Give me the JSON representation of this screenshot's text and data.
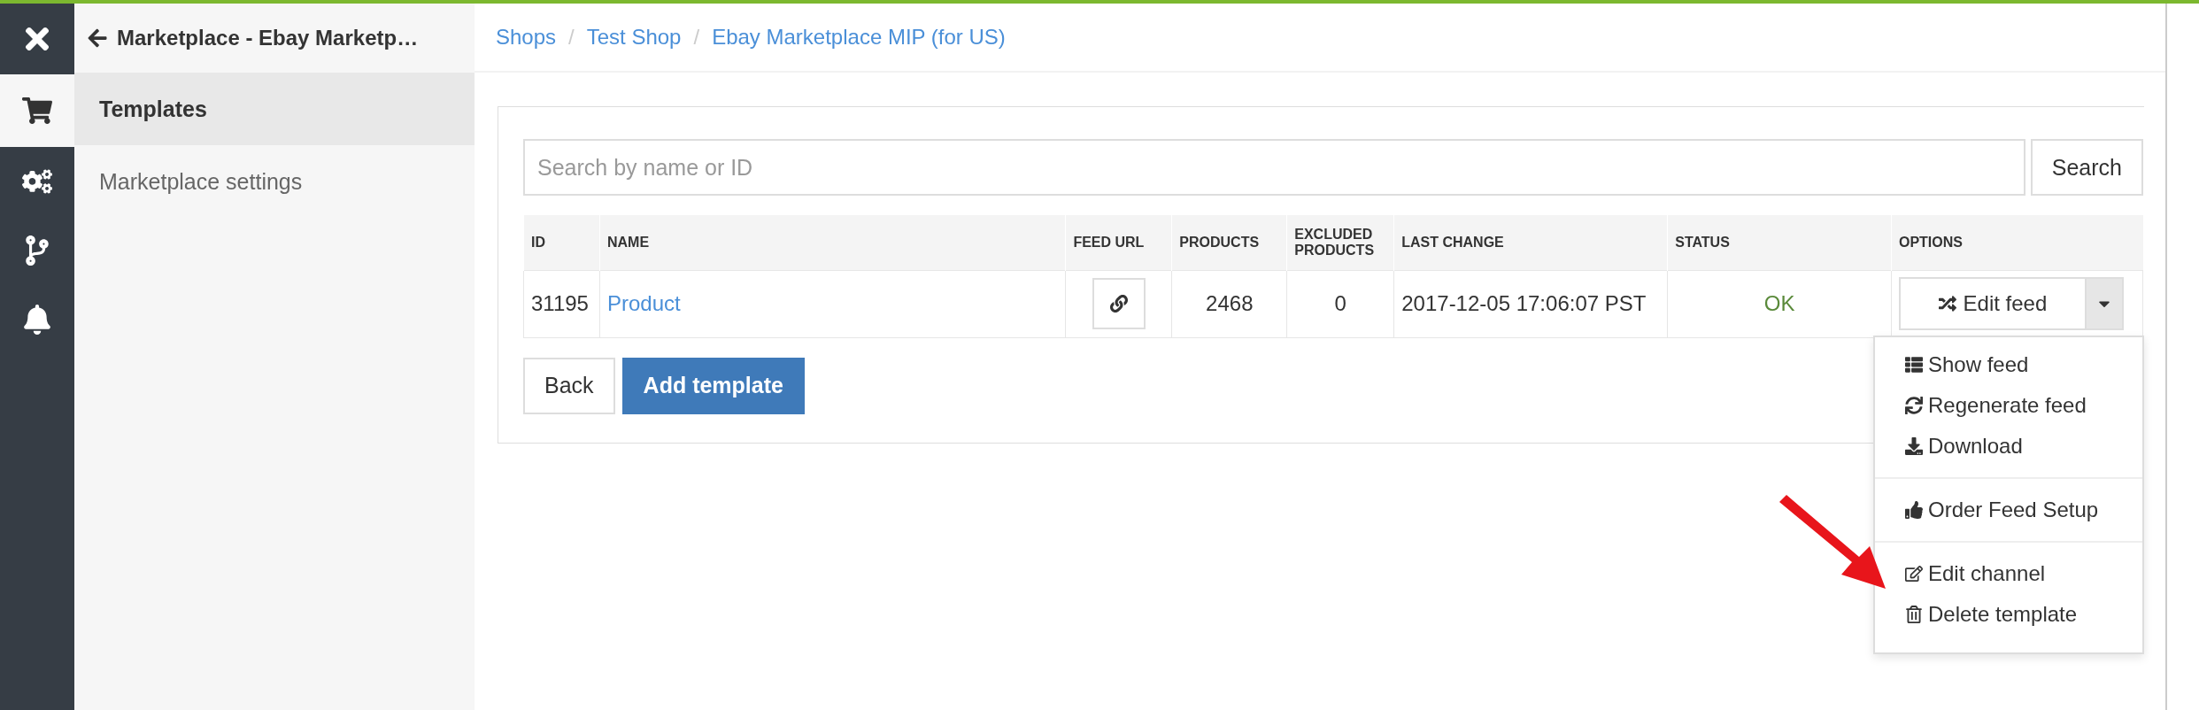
{
  "rail": {
    "items": [
      {
        "kind": "cart",
        "selected": true
      },
      {
        "kind": "settings",
        "selected": false
      },
      {
        "kind": "branch",
        "selected": false
      },
      {
        "kind": "bell",
        "selected": false
      }
    ]
  },
  "sidebar": {
    "title": "Marketplace - Ebay Marketp…",
    "items": [
      {
        "label": "Templates",
        "selected": true
      },
      {
        "label": "Marketplace settings",
        "selected": false
      }
    ]
  },
  "breadcrumb": {
    "separator": "/",
    "items": [
      "Shops",
      "Test Shop",
      "Ebay Marketplace MIP (for US)"
    ]
  },
  "search": {
    "placeholder": "Search by name or ID",
    "button": "Search"
  },
  "table": {
    "columns": [
      "ID",
      "NAME",
      "FEED URL",
      "PRODUCTS",
      "EXCLUDED PRODUCTS",
      "LAST CHANGE",
      "STATUS",
      "OPTIONS"
    ],
    "rows": [
      {
        "id": "31195",
        "name": "Product",
        "products": "2468",
        "excluded": "0",
        "last_change": "2017-12-05 17:06:07 PST",
        "status": "OK",
        "option": "Edit feed",
        "menu_open": true
      }
    ]
  },
  "menu": {
    "sections": [
      {
        "items": [
          {
            "kind": "list",
            "label": "Show feed"
          },
          {
            "kind": "refresh",
            "label": "Regenerate feed"
          },
          {
            "kind": "download",
            "label": "Download"
          }
        ]
      },
      {
        "items": [
          {
            "kind": "thumbs",
            "label": "Order Feed Setup"
          }
        ]
      },
      {
        "items": [
          {
            "kind": "edit",
            "label": "Edit channel"
          },
          {
            "kind": "trash",
            "label": "Delete template"
          }
        ]
      }
    ]
  },
  "buttons": {
    "back": "Back",
    "add": "Add template"
  }
}
